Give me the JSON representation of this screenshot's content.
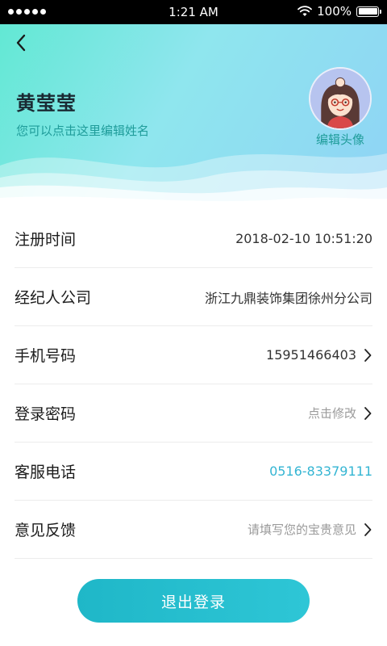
{
  "status_bar": {
    "time": "1:21 AM",
    "battery": "100%"
  },
  "profile": {
    "name": "黄莹莹",
    "edit_name_hint": "您可以点击这里编辑姓名",
    "edit_avatar_label": "编辑头像"
  },
  "info": {
    "register_time": {
      "label": "注册时间",
      "value": "2018-02-10 10:51:20"
    },
    "agent_company": {
      "label": "经纪人公司",
      "value": "浙江九鼎装饰集团徐州分公司"
    },
    "phone": {
      "label": "手机号码",
      "value": "15951466403"
    },
    "password": {
      "label": "登录密码",
      "value": "点击修改"
    },
    "service_phone": {
      "label": "客服电话",
      "value": "0516-83379111"
    },
    "feedback": {
      "label": "意见反馈",
      "value": "请填写您的宝贵意见"
    }
  },
  "logout_label": "退出登录",
  "colors": {
    "accent": "#2ec6d6",
    "hint_text": "#1f9c9a",
    "link": "#34b5d3"
  },
  "icons": {
    "back": "chevron-left-icon",
    "row_arrow": "chevron-right-icon",
    "wifi": "wifi-icon",
    "battery": "battery-icon",
    "signal": "signal-dots-icon"
  }
}
